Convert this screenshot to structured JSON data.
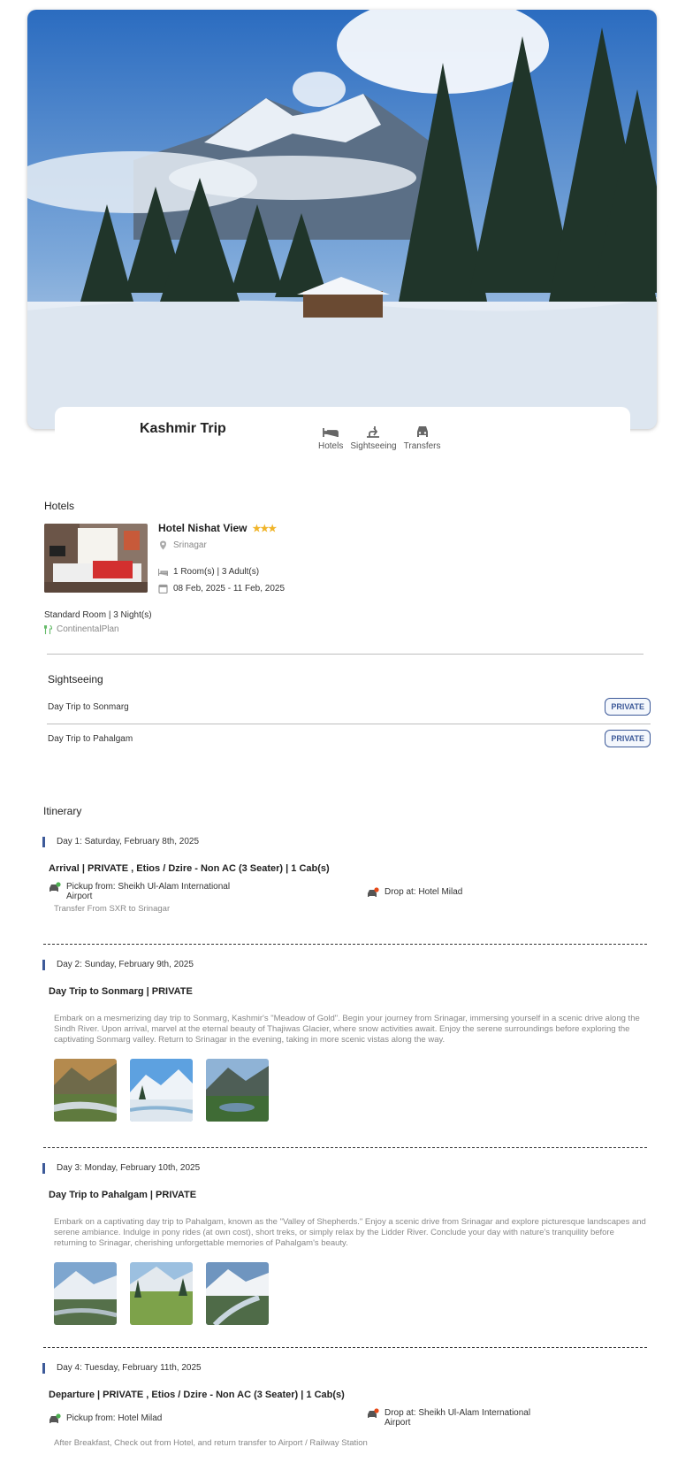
{
  "trip": {
    "title": "Kashmir Trip",
    "nav": [
      {
        "label": "Hotels",
        "icon": "bed-icon"
      },
      {
        "label": "Sightseeing",
        "icon": "sightseeing-icon"
      },
      {
        "label": "Transfers",
        "icon": "car-icon"
      }
    ]
  },
  "hotels": {
    "heading": "Hotels",
    "name": "Hotel Nishat View",
    "stars": "★★★",
    "location": "Srinagar",
    "rooms": "1 Room(s) | 3 Adult(s)",
    "dates": "08 Feb, 2025 - 11 Feb, 2025",
    "room_type": "Standard Room | 3 Night(s)",
    "meal_plan": "ContinentalPlan"
  },
  "sightseeing": {
    "heading": "Sightseeing",
    "items": [
      {
        "name": "Day Trip to Sonmarg",
        "badge": "PRIVATE"
      },
      {
        "name": "Day Trip to Pahalgam",
        "badge": "PRIVATE"
      }
    ]
  },
  "itinerary": {
    "heading": "Itinerary",
    "days": [
      {
        "header": "Day 1: Saturday, February 8th, 2025",
        "title": "Arrival | PRIVATE , Etios / Dzire - Non AC (3 Seater) | 1 Cab(s)",
        "pickup": "Pickup from: Sheikh Ul-Alam International Airport",
        "drop": "Drop at: Hotel Milad",
        "note": "Transfer From SXR to Srinagar"
      },
      {
        "header": "Day 2: Sunday, February 9th, 2025",
        "title": "Day Trip to Sonmarg | PRIVATE",
        "description": "Embark on a mesmerizing day trip to Sonmarg, Kashmir's \"Meadow of Gold\". Begin your journey from Srinagar, immersing yourself in a scenic drive along the Sindh River. Upon arrival, marvel at the eternal beauty of Thajiwas Glacier, where snow activities await. Enjoy the serene surroundings before exploring the captivating Sonmarg valley. Return to Srinagar in the evening, taking in more scenic vistas along the way."
      },
      {
        "header": "Day 3: Monday, February 10th, 2025",
        "title": "Day Trip to Pahalgam | PRIVATE",
        "description": "Embark on a captivating day trip to Pahalgam, known as the \"Valley of Shepherds.\" Enjoy a scenic drive from Srinagar and explore picturesque landscapes and serene ambiance. Indulge in pony rides (at own cost), short treks, or simply relax by the Lidder River. Conclude your day with nature's tranquility before returning to Srinagar, cherishing unforgettable memories of Pahalgam's beauty."
      },
      {
        "header": "Day 4: Tuesday, February 11th, 2025",
        "title": "Departure | PRIVATE , Etios / Dzire - Non AC (3 Seater) | 1 Cab(s)",
        "pickup": "Pickup from: Hotel Milad",
        "drop": "Drop at: Sheikh Ul-Alam International Airport",
        "note": "After Breakfast, Check out from Hotel, and return transfer to Airport / Railway Station"
      }
    ]
  },
  "colors": {
    "accent": "#3d5a99",
    "star": "#f0b429",
    "pickup": "#4caf50",
    "drop": "#e64a19"
  }
}
